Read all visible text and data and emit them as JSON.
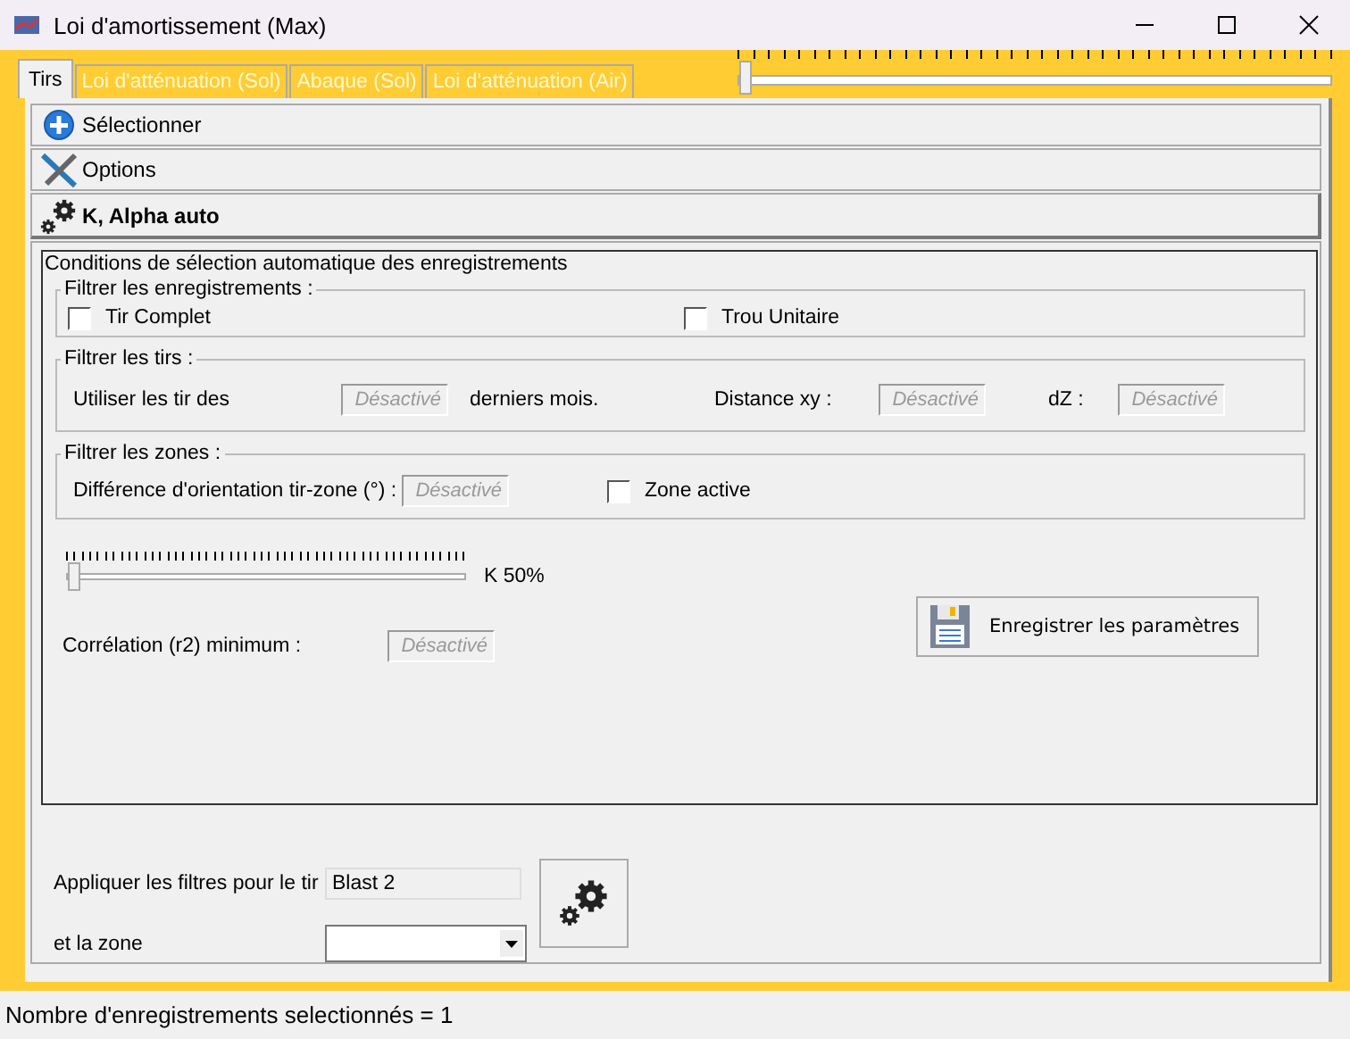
{
  "window": {
    "title": "Loi d'amortissement (Max)"
  },
  "tabs": [
    {
      "label": "Tirs",
      "selected": true
    },
    {
      "label": "Loi d'atténuation (Sol)",
      "selected": false
    },
    {
      "label": "Abaque (Sol)",
      "selected": false
    },
    {
      "label": "Loi d'atténuation (Air)",
      "selected": false
    }
  ],
  "top_slider": {
    "level": 0
  },
  "sections": [
    {
      "label": "Sélectionner",
      "kind": "plus",
      "expanded": false
    },
    {
      "label": "Options",
      "kind": "tools",
      "expanded": false
    },
    {
      "label": "K, Alpha auto",
      "kind": "gears",
      "expanded": true
    }
  ],
  "conditions": {
    "title": "Conditions de sélection automatique des enregistrements",
    "records": {
      "legend": "Filtrer les enregistrements :",
      "checkboxes": [
        {
          "label": "Tir Complet",
          "checked": false
        },
        {
          "label": "Trou Unitaire",
          "checked": false
        }
      ]
    },
    "shots": {
      "legend": "Filtrer les tirs :",
      "use_label": "Utiliser les tir des",
      "months_field": {
        "placeholder": "Désactivé"
      },
      "months_label": "derniers mois.",
      "distance_label": "Distance xy :",
      "distance_field": {
        "placeholder": "Désactivé"
      },
      "dz_label": "dZ :",
      "dz_field": {
        "placeholder": "Désactivé"
      }
    },
    "zones": {
      "legend": "Filtrer les zones :",
      "orientation_label": "Différence d'orientation tir-zone (°) :",
      "orientation_field": {
        "placeholder": "Désactivé"
      },
      "active_zone": {
        "label": "Zone active",
        "checked": false
      }
    },
    "k_slider": {
      "level": 0
    },
    "k_reading": "K 50%",
    "correlation_label": "Corrélation (r2) minimum :",
    "correlation_field": {
      "placeholder": "Désactivé"
    },
    "save_button": "Enregistrer les paramètres"
  },
  "apply": {
    "shot_label": "Appliquer les filtres pour le tir",
    "shot_value": "Blast 2",
    "zone_label": "et la zone"
  },
  "status_bar": "Nombre d'enregistrements selectionnés = 1"
}
